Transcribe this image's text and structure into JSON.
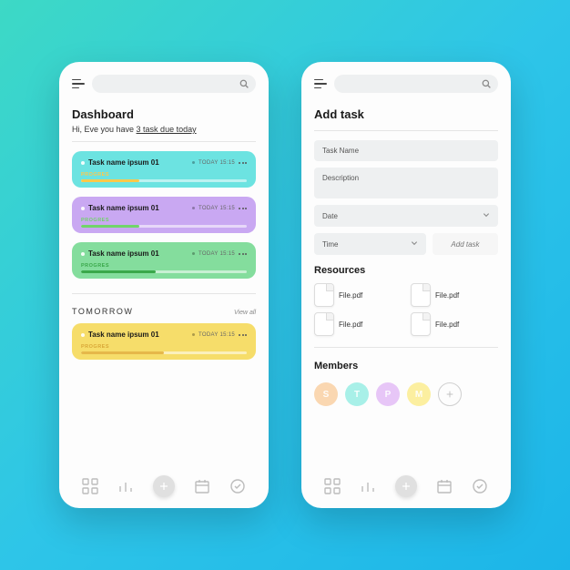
{
  "screen1": {
    "title": "Dashboard",
    "greeting_prefix": "Hi, Eve you have ",
    "greeting_underline": "3 task due today",
    "tasks": [
      {
        "name": "Task name ipsum 01",
        "time": "TODAY 15:15",
        "progress_label": "PROGRES",
        "progress_pct": 35,
        "bg": "#6CE3E1",
        "bar": "#ffc94a"
      },
      {
        "name": "Task name ipsum 01",
        "time": "TODAY 15:15",
        "progress_label": "PROGRES",
        "progress_pct": 35,
        "bg": "#C9A8F2",
        "bar": "#71d46a"
      },
      {
        "name": "Task name ipsum 01",
        "time": "TODAY 15:15",
        "progress_label": "PROGRES",
        "progress_pct": 45,
        "bg": "#84DD9D",
        "bar": "#3aa84a"
      }
    ],
    "tomorrow_label": "TOMORROW",
    "view_all": "View all",
    "tomorrow_task": {
      "name": "Task name ipsum 01",
      "time": "TODAY 15:15",
      "progress_label": "PROGRES",
      "progress_pct": 50,
      "bg": "#F6DD6A",
      "bar": "#e6b84a"
    }
  },
  "screen2": {
    "title": "Add task",
    "fields": {
      "task_name": "Task Name",
      "description": "Description",
      "date": "Date",
      "time": "Time",
      "add_button": "Add task"
    },
    "resources_label": "Resources",
    "files": [
      {
        "label": "File.pdf"
      },
      {
        "label": "File.pdf"
      },
      {
        "label": "File.pdf"
      },
      {
        "label": "File.pdf"
      }
    ],
    "members_label": "Members",
    "members": [
      {
        "initial": "S",
        "color": "#FAD7B1"
      },
      {
        "initial": "T",
        "color": "#A8F0E8"
      },
      {
        "initial": "P",
        "color": "#E7C6F7"
      },
      {
        "initial": "M",
        "color": "#FCEFA0"
      }
    ]
  }
}
